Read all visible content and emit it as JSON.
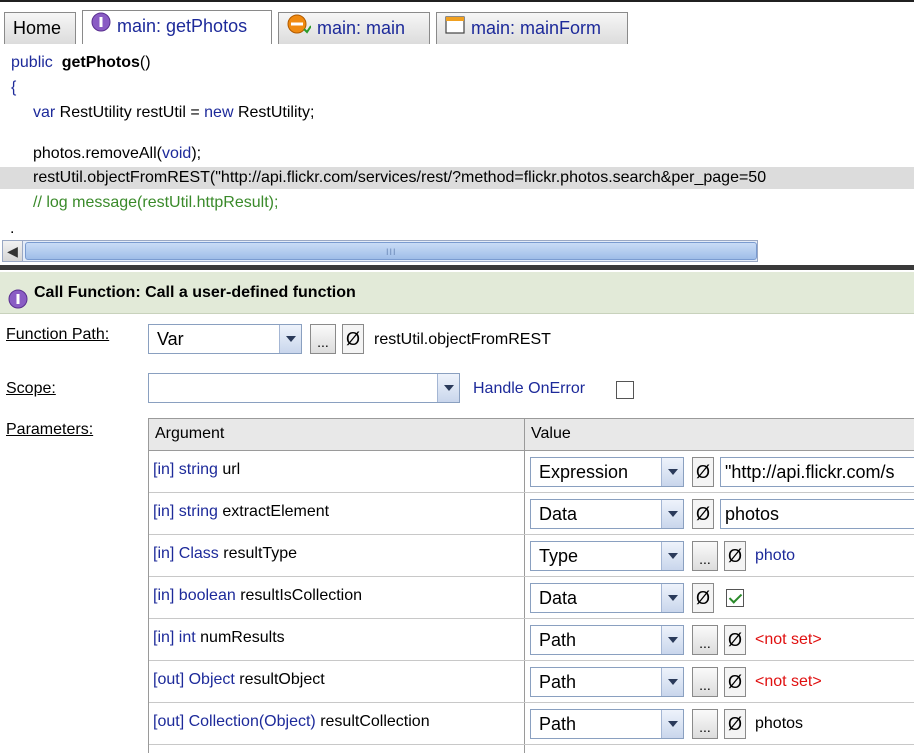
{
  "tabs": [
    {
      "label": "Home",
      "icon": "home"
    },
    {
      "label": "main: getPhotos",
      "icon": "function-icon"
    },
    {
      "label": "main: main",
      "icon": "process-icon"
    },
    {
      "label": "main: mainForm",
      "icon": "form-icon"
    }
  ],
  "code": {
    "l1_kw": "public",
    "l1_fn": "getPhotos",
    "l1_paren": "()",
    "l2": "{",
    "l3_var": "var",
    "l3_a": " RestUtility restUtil = ",
    "l3_new": "new",
    "l3_b": " RestUtility;",
    "l4_a": "photos.removeAll(",
    "l4_void": "void",
    "l4_b": ");",
    "l5": "restUtil.objectFromREST(\"http://api.flickr.com/services/rest/?method=flickr.photos.search&per_page=50",
    "l6": "// log message(restUtil.httpResult);",
    "l7": "."
  },
  "scrollbar": {
    "grip": "III"
  },
  "panel": {
    "title": "Call Function: Call a user-defined function",
    "function_path": {
      "label": "Function Path:",
      "mode": "Var",
      "ellipsis": "...",
      "null_symbol": "Ø",
      "value": "restUtil.objectFromREST"
    },
    "scope": {
      "label": "Scope:",
      "value": "",
      "handle_onerror": "Handle OnError",
      "handle_onerror_checked": false
    },
    "parameters": {
      "label": "Parameters:",
      "col_argument": "Argument",
      "col_value": "Value",
      "rows": [
        {
          "dir": "[in]",
          "type": "string",
          "name": "url",
          "mode": "Expression",
          "value": "\"http://api.flickr.com/s"
        },
        {
          "dir": "[in]",
          "type": "string",
          "name": "extractElement",
          "mode": "Data",
          "value": "photos"
        },
        {
          "dir": "[in]",
          "type": "Class",
          "name": "resultType",
          "mode": "Type",
          "value": "photo"
        },
        {
          "dir": "[in]",
          "type": "boolean",
          "name": "resultIsCollection",
          "mode": "Data",
          "value": "",
          "checked": true
        },
        {
          "dir": "[in]",
          "type": "int",
          "name": "numResults",
          "mode": "Path",
          "value": "<not set>"
        },
        {
          "dir": "[out]",
          "type": "Object",
          "name": "resultObject",
          "mode": "Path",
          "value": "<not set>"
        },
        {
          "dir": "[out]",
          "type": "Collection(Object)",
          "name": "resultCollection",
          "mode": "Path",
          "value": "photos"
        }
      ]
    }
  },
  "colors": {
    "keyword": "#1d2a9a",
    "comment": "#3a8a2a",
    "not_set": "#e01010",
    "header_bg": "#e2ead8"
  }
}
